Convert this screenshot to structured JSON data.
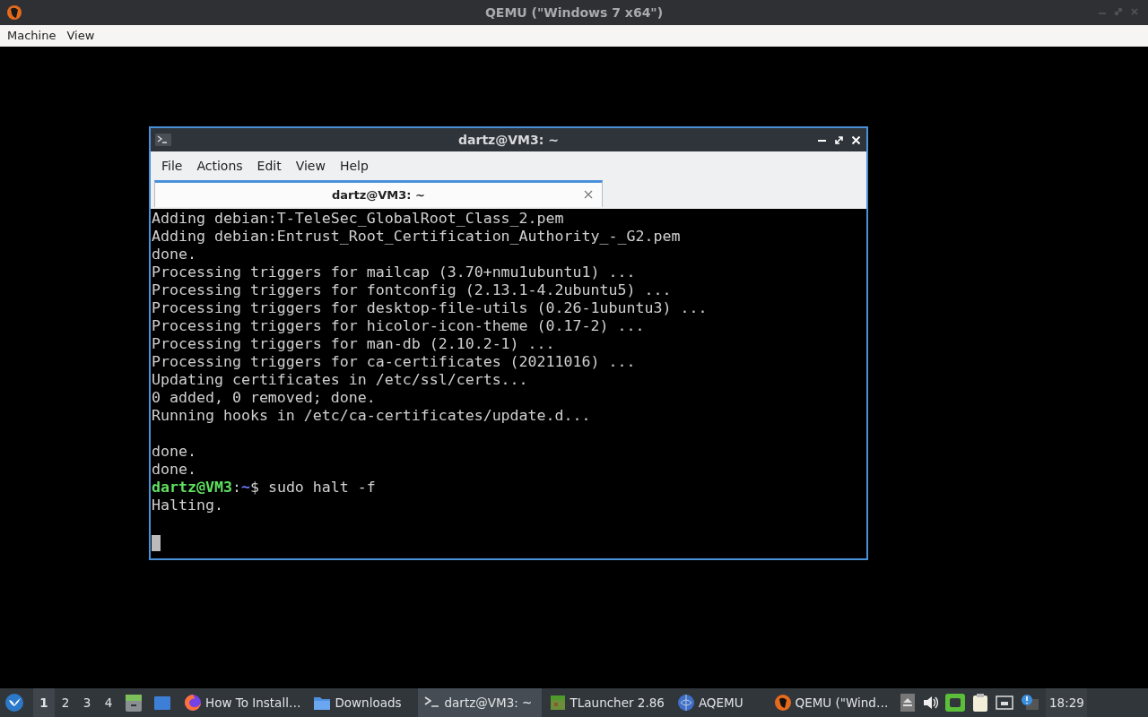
{
  "window": {
    "title": "QEMU (\"Windows 7 x64\")"
  },
  "menu": [
    "Machine",
    "View"
  ],
  "terminal": {
    "title": "dartz@VM3: ~",
    "menu": [
      "File",
      "Actions",
      "Edit",
      "View",
      "Help"
    ],
    "tabs": [
      {
        "label": "dartz@VM3: ~",
        "selected": true
      }
    ],
    "lines": [
      {
        "kind": "output",
        "text": "Adding debian:T-TeleSec_GlobalRoot_Class_2.pem"
      },
      {
        "kind": "output",
        "text": "Adding debian:Entrust_Root_Certification_Authority_-_G2.pem"
      },
      {
        "kind": "output",
        "text": "done."
      },
      {
        "kind": "output",
        "text": "Processing triggers for mailcap (3.70+nmu1ubuntu1) ..."
      },
      {
        "kind": "output",
        "text": "Processing triggers for fontconfig (2.13.1-4.2ubuntu5) ..."
      },
      {
        "kind": "output",
        "text": "Processing triggers for desktop-file-utils (0.26-1ubuntu3) ..."
      },
      {
        "kind": "output",
        "text": "Processing triggers for hicolor-icon-theme (0.17-2) ..."
      },
      {
        "kind": "output",
        "text": "Processing triggers for man-db (2.10.2-1) ..."
      },
      {
        "kind": "output",
        "text": "Processing triggers for ca-certificates (20211016) ..."
      },
      {
        "kind": "output",
        "text": "Updating certificates in /etc/ssl/certs..."
      },
      {
        "kind": "output",
        "text": "0 added, 0 removed; done."
      },
      {
        "kind": "output",
        "text": "Running hooks in /etc/ca-certificates/update.d..."
      },
      {
        "kind": "blank"
      },
      {
        "kind": "output",
        "text": "done."
      },
      {
        "kind": "output",
        "text": "done."
      },
      {
        "kind": "prompt",
        "user": "dartz@VM3",
        "sep": ":",
        "path": "~",
        "command": "$ sudo halt -f"
      },
      {
        "kind": "output",
        "text": "Halting."
      },
      {
        "kind": "blank"
      },
      {
        "kind": "cursor"
      }
    ]
  },
  "taskbar": {
    "workspaces": [
      {
        "label": "1",
        "selected": true
      },
      {
        "label": "2",
        "selected": false
      },
      {
        "label": "3",
        "selected": false
      },
      {
        "label": "4",
        "selected": false
      }
    ],
    "tasks": [
      {
        "label": "How To Install…",
        "kind": "browser",
        "selected": false
      },
      {
        "label": "Downloads",
        "kind": "folder",
        "selected": false
      },
      {
        "label": "dartz@VM3: ~",
        "kind": "terminal",
        "selected": true
      },
      {
        "label": "TLauncher 2.86",
        "kind": "block",
        "selected": false
      },
      {
        "label": "AQEMU",
        "kind": "globe",
        "selected": false
      },
      {
        "label": "QEMU (\"Wind…",
        "kind": "qemu",
        "selected": false
      }
    ],
    "clock": "18:29"
  }
}
